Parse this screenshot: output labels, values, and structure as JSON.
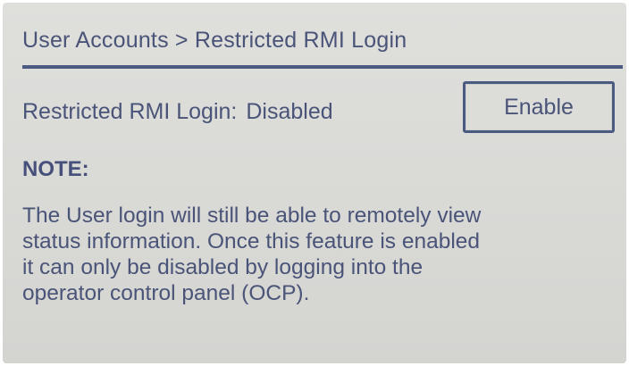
{
  "header": {
    "breadcrumb": "User Accounts > Restricted RMI Login"
  },
  "status": {
    "label": "Restricted RMI Login:",
    "value": "Disabled"
  },
  "buttons": {
    "enable_label": "Enable"
  },
  "note": {
    "heading": "NOTE:",
    "lines": [
      "The User login will still be able to remotely view",
      "status information. Once this feature is enabled",
      "it can only be disabled by logging into the",
      "operator control panel (OCP)."
    ]
  },
  "colors": {
    "screen_background": "#dcdcd9",
    "text": "#4a5478",
    "rule": "#4a5a80"
  }
}
